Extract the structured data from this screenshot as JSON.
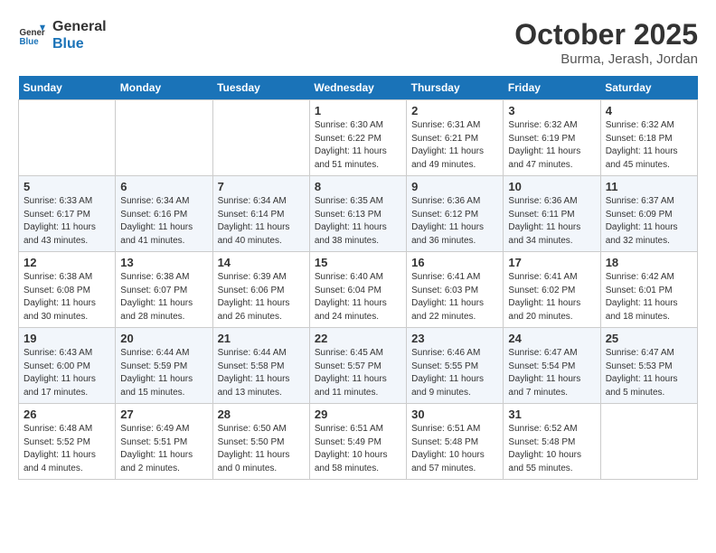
{
  "header": {
    "logo_line1": "General",
    "logo_line2": "Blue",
    "month": "October 2025",
    "location": "Burma, Jerash, Jordan"
  },
  "days_of_week": [
    "Sunday",
    "Monday",
    "Tuesday",
    "Wednesday",
    "Thursday",
    "Friday",
    "Saturday"
  ],
  "weeks": [
    [
      {
        "day": "",
        "info": ""
      },
      {
        "day": "",
        "info": ""
      },
      {
        "day": "",
        "info": ""
      },
      {
        "day": "1",
        "info": "Sunrise: 6:30 AM\nSunset: 6:22 PM\nDaylight: 11 hours\nand 51 minutes."
      },
      {
        "day": "2",
        "info": "Sunrise: 6:31 AM\nSunset: 6:21 PM\nDaylight: 11 hours\nand 49 minutes."
      },
      {
        "day": "3",
        "info": "Sunrise: 6:32 AM\nSunset: 6:19 PM\nDaylight: 11 hours\nand 47 minutes."
      },
      {
        "day": "4",
        "info": "Sunrise: 6:32 AM\nSunset: 6:18 PM\nDaylight: 11 hours\nand 45 minutes."
      }
    ],
    [
      {
        "day": "5",
        "info": "Sunrise: 6:33 AM\nSunset: 6:17 PM\nDaylight: 11 hours\nand 43 minutes."
      },
      {
        "day": "6",
        "info": "Sunrise: 6:34 AM\nSunset: 6:16 PM\nDaylight: 11 hours\nand 41 minutes."
      },
      {
        "day": "7",
        "info": "Sunrise: 6:34 AM\nSunset: 6:14 PM\nDaylight: 11 hours\nand 40 minutes."
      },
      {
        "day": "8",
        "info": "Sunrise: 6:35 AM\nSunset: 6:13 PM\nDaylight: 11 hours\nand 38 minutes."
      },
      {
        "day": "9",
        "info": "Sunrise: 6:36 AM\nSunset: 6:12 PM\nDaylight: 11 hours\nand 36 minutes."
      },
      {
        "day": "10",
        "info": "Sunrise: 6:36 AM\nSunset: 6:11 PM\nDaylight: 11 hours\nand 34 minutes."
      },
      {
        "day": "11",
        "info": "Sunrise: 6:37 AM\nSunset: 6:09 PM\nDaylight: 11 hours\nand 32 minutes."
      }
    ],
    [
      {
        "day": "12",
        "info": "Sunrise: 6:38 AM\nSunset: 6:08 PM\nDaylight: 11 hours\nand 30 minutes."
      },
      {
        "day": "13",
        "info": "Sunrise: 6:38 AM\nSunset: 6:07 PM\nDaylight: 11 hours\nand 28 minutes."
      },
      {
        "day": "14",
        "info": "Sunrise: 6:39 AM\nSunset: 6:06 PM\nDaylight: 11 hours\nand 26 minutes."
      },
      {
        "day": "15",
        "info": "Sunrise: 6:40 AM\nSunset: 6:04 PM\nDaylight: 11 hours\nand 24 minutes."
      },
      {
        "day": "16",
        "info": "Sunrise: 6:41 AM\nSunset: 6:03 PM\nDaylight: 11 hours\nand 22 minutes."
      },
      {
        "day": "17",
        "info": "Sunrise: 6:41 AM\nSunset: 6:02 PM\nDaylight: 11 hours\nand 20 minutes."
      },
      {
        "day": "18",
        "info": "Sunrise: 6:42 AM\nSunset: 6:01 PM\nDaylight: 11 hours\nand 18 minutes."
      }
    ],
    [
      {
        "day": "19",
        "info": "Sunrise: 6:43 AM\nSunset: 6:00 PM\nDaylight: 11 hours\nand 17 minutes."
      },
      {
        "day": "20",
        "info": "Sunrise: 6:44 AM\nSunset: 5:59 PM\nDaylight: 11 hours\nand 15 minutes."
      },
      {
        "day": "21",
        "info": "Sunrise: 6:44 AM\nSunset: 5:58 PM\nDaylight: 11 hours\nand 13 minutes."
      },
      {
        "day": "22",
        "info": "Sunrise: 6:45 AM\nSunset: 5:57 PM\nDaylight: 11 hours\nand 11 minutes."
      },
      {
        "day": "23",
        "info": "Sunrise: 6:46 AM\nSunset: 5:55 PM\nDaylight: 11 hours\nand 9 minutes."
      },
      {
        "day": "24",
        "info": "Sunrise: 6:47 AM\nSunset: 5:54 PM\nDaylight: 11 hours\nand 7 minutes."
      },
      {
        "day": "25",
        "info": "Sunrise: 6:47 AM\nSunset: 5:53 PM\nDaylight: 11 hours\nand 5 minutes."
      }
    ],
    [
      {
        "day": "26",
        "info": "Sunrise: 6:48 AM\nSunset: 5:52 PM\nDaylight: 11 hours\nand 4 minutes."
      },
      {
        "day": "27",
        "info": "Sunrise: 6:49 AM\nSunset: 5:51 PM\nDaylight: 11 hours\nand 2 minutes."
      },
      {
        "day": "28",
        "info": "Sunrise: 6:50 AM\nSunset: 5:50 PM\nDaylight: 11 hours\nand 0 minutes."
      },
      {
        "day": "29",
        "info": "Sunrise: 6:51 AM\nSunset: 5:49 PM\nDaylight: 10 hours\nand 58 minutes."
      },
      {
        "day": "30",
        "info": "Sunrise: 6:51 AM\nSunset: 5:48 PM\nDaylight: 10 hours\nand 57 minutes."
      },
      {
        "day": "31",
        "info": "Sunrise: 6:52 AM\nSunset: 5:48 PM\nDaylight: 10 hours\nand 55 minutes."
      },
      {
        "day": "",
        "info": ""
      }
    ]
  ]
}
